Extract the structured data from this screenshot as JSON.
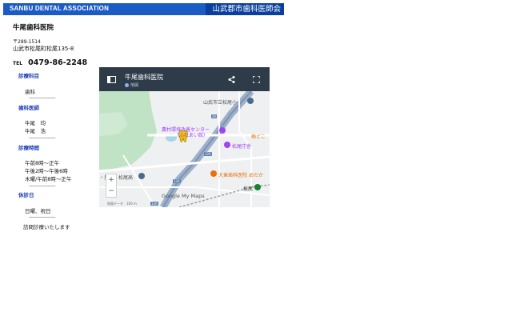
{
  "header": {
    "association": "SANBU DENTAL ASSOCIATION",
    "city_association": "山武郡市歯科医師会",
    "colors": {
      "bar": "#1a5bc4",
      "badge": "#0b3f9e"
    }
  },
  "clinic": {
    "name": "牛尾歯科医院",
    "postal": "〒289-1514",
    "address": "山武市松尾町松尾135-8",
    "tel_label": "TEL",
    "tel": "0479-86-2248"
  },
  "sections": {
    "department": {
      "title": "診療科目",
      "items": [
        "歯科"
      ]
    },
    "doctors": {
      "title": "歯科医師",
      "items": [
        "牛尾　均",
        "牛尾　浩"
      ]
    },
    "hours": {
      "title": "診療時間",
      "items": [
        "午前8時〜正午",
        "午後2時〜午後6時",
        "木曜/午前8時〜正午"
      ]
    },
    "holidays": {
      "title": "休診日",
      "items": [
        "日曜、祝日"
      ]
    },
    "home_visit": "訪問診療いたします",
    "separator": "——————",
    "title_color": "#1a3bb5"
  },
  "map": {
    "title": "牛尾歯科医院",
    "subtitle": "地図",
    "labels": {
      "school": "山武市立松尾小",
      "center": "農村環境改善センター",
      "center_sub": "（ふれあい館）",
      "hall": "松尾庁舎",
      "dental": "大東歯科医院",
      "dental_suffix": "めだか",
      "plum": "梅どこ",
      "high_school": "松尾高",
      "station": "松尾",
      "left_edge": "・星"
    },
    "routes": [
      "26",
      "126",
      "126",
      "126"
    ],
    "watermark": "Google My Maps",
    "footer": "地図データ　100 m",
    "zoom_in": "+",
    "zoom_out": "−",
    "icons": [
      "sidebar-icon",
      "share-icon",
      "fullscreen-icon",
      "tooth-marker-icon",
      "place-marker-icon"
    ]
  }
}
